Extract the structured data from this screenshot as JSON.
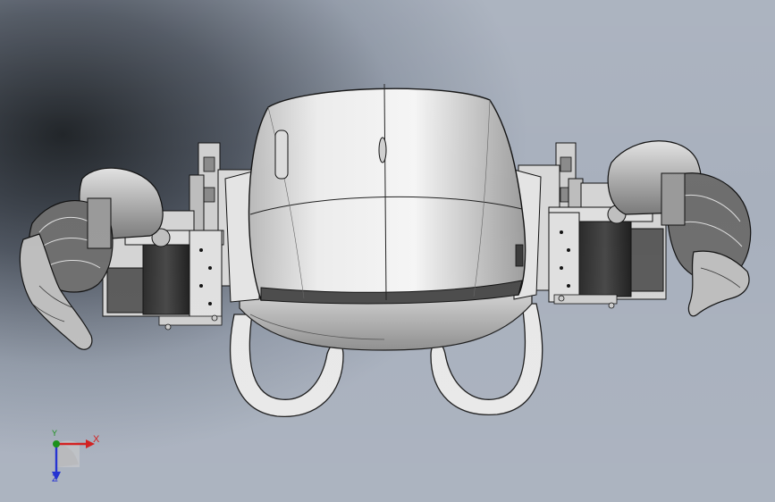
{
  "viewport": {
    "model": "robot-top-view"
  },
  "triad": {
    "x_label": "X",
    "y_label": "Y",
    "z_label": "Z",
    "x_color": "#d01818",
    "y_color": "#118c11",
    "z_color": "#1c2bd0"
  }
}
